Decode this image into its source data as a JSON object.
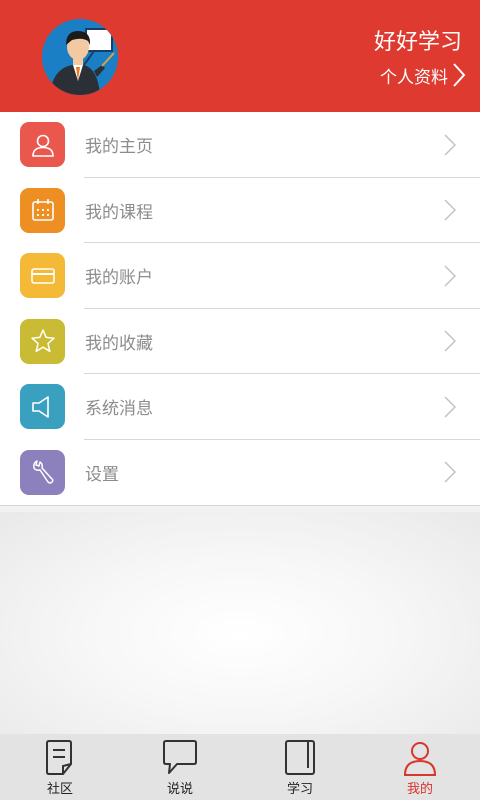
{
  "header": {
    "nickname": "好好学习",
    "profile_link": "个人资料"
  },
  "colors": {
    "header_bg": "#de3a30",
    "active_tab": "#d8352c"
  },
  "menu": [
    {
      "label": "我的主页",
      "icon": "user-icon",
      "color": "#e9574d"
    },
    {
      "label": "我的课程",
      "icon": "calendar-icon",
      "color": "#ee8f23"
    },
    {
      "label": "我的账户",
      "icon": "card-icon",
      "color": "#f4b936"
    },
    {
      "label": "我的收藏",
      "icon": "star-icon",
      "color": "#c9bb34"
    },
    {
      "label": "系统消息",
      "icon": "speaker-icon",
      "color": "#3aa0c0"
    },
    {
      "label": "设置",
      "icon": "wrench-icon",
      "color": "#8c80bd"
    }
  ],
  "tabs": [
    {
      "label": "社区",
      "icon": "community-icon",
      "active": false
    },
    {
      "label": "说说",
      "icon": "chat-icon",
      "active": false
    },
    {
      "label": "学习",
      "icon": "book-icon",
      "active": false
    },
    {
      "label": "我的",
      "icon": "user-icon",
      "active": true
    }
  ]
}
